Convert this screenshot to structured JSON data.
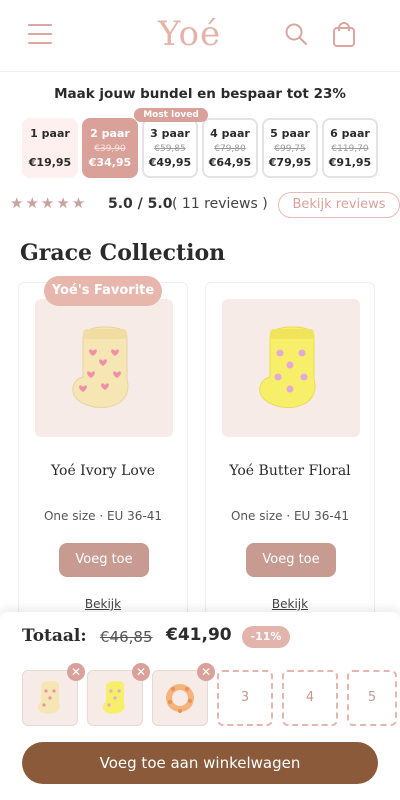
{
  "header": {
    "logo": "Yoé",
    "icons": [
      "menu-icon",
      "search-icon",
      "shopping-bag-icon"
    ]
  },
  "bundle": {
    "title": "Maak jouw bundel en bespaar tot 23%",
    "most_loved_label": "Most loved",
    "options": [
      {
        "qty": "1 paar",
        "old_price": "",
        "price": "€19,95"
      },
      {
        "qty": "2 paar",
        "old_price": "€39,90",
        "price": "€34,95"
      },
      {
        "qty": "3 paar",
        "old_price": "€59,85",
        "price": "€49,95"
      },
      {
        "qty": "4 paar",
        "old_price": "€79,80",
        "price": "€64,95"
      },
      {
        "qty": "5 paar",
        "old_price": "€99,75",
        "price": "€79,95"
      },
      {
        "qty": "6 paar",
        "old_price": "€119,70",
        "price": "€91,95"
      }
    ]
  },
  "reviews": {
    "stars": "★★★★★",
    "score": "5.0 / 5.0",
    "count": "( 11 reviews )",
    "button_label": "Bekijk reviews"
  },
  "collection": {
    "title": "Grace Collection",
    "favorite_badge": "Yoé's Favorite",
    "products": [
      {
        "name": "Yoé Ivory Love",
        "size": "One size · EU 36-41",
        "add_label": "Voeg toe",
        "view_label": "Bekijk"
      },
      {
        "name": "Yoé Butter Floral",
        "size": "One size · EU 36-41",
        "add_label": "Voeg toe",
        "view_label": "Bekijk"
      }
    ]
  },
  "cart_panel": {
    "total_label": "Totaal:",
    "old_total": "€46,85",
    "new_total": "€41,90",
    "discount": "-11%",
    "empty_slots": [
      "3",
      "4",
      "5"
    ],
    "remove_glyph": "✕",
    "checkout_label": "Voeg toe aan winkelwagen"
  },
  "colors": {
    "accent": "#d9a19a",
    "brand_brown": "#8a5a3a",
    "logo": "#e6b3ab"
  }
}
